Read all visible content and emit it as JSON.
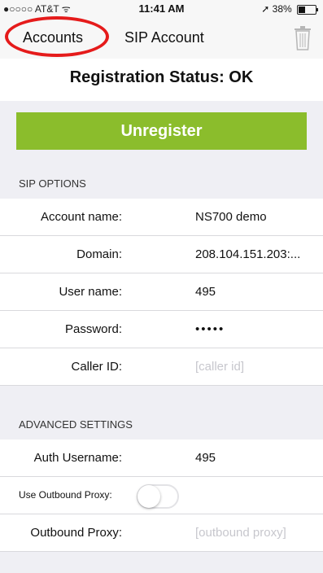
{
  "status_bar": {
    "carrier": "●○○○○ AT&T ᯤ",
    "time": "11:41 AM",
    "battery_text": "➚ 38%",
    "battery_level": 0.38
  },
  "nav": {
    "back_label": "Accounts",
    "title": "SIP Account",
    "trash_icon": "trash-icon"
  },
  "registration": {
    "status_text": "Registration Status: OK",
    "button_label": "Unregister"
  },
  "sip_options": {
    "header": "SIP OPTIONS",
    "fields": [
      {
        "label": "Account name:",
        "value": "NS700 demo"
      },
      {
        "label": "Domain:",
        "value": "208.104.151.203:..."
      },
      {
        "label": "User name:",
        "value": "495"
      },
      {
        "label": "Password:",
        "value": "•••••"
      },
      {
        "label": "Caller ID:",
        "placeholder": "[caller id]"
      }
    ]
  },
  "advanced": {
    "header": "ADVANCED SETTINGS",
    "auth_username_label": "Auth Username:",
    "auth_username_value": "495",
    "use_outbound_proxy_label": "Use Outbound Proxy:",
    "use_outbound_proxy_on": false,
    "outbound_proxy_label": "Outbound Proxy:",
    "outbound_proxy_placeholder": "[outbound proxy]"
  },
  "colors": {
    "accent_green": "#8bbd2c",
    "highlight_red": "#e51b1b"
  }
}
